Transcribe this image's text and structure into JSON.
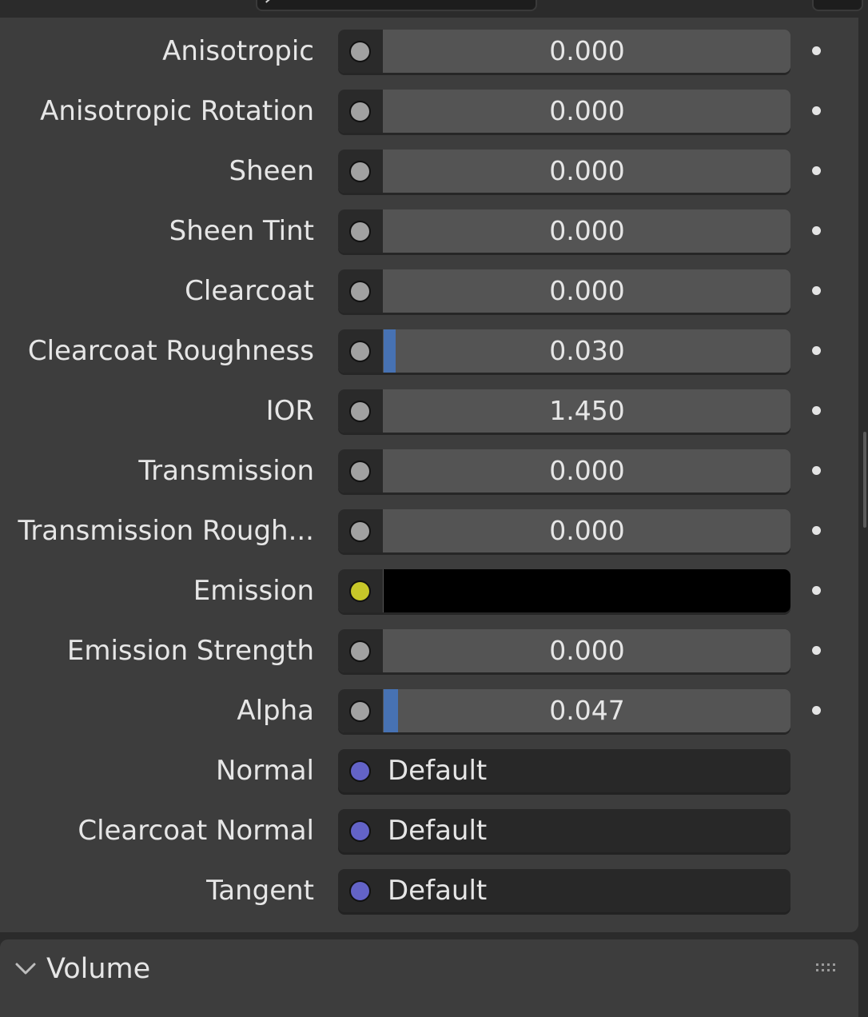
{
  "rows": [
    {
      "label": "Anisotropic",
      "kind": "value",
      "value": "0.000",
      "fill_fraction": 0.0,
      "socket_color": "#a1a1a1"
    },
    {
      "label": "Anisotropic Rotation",
      "kind": "value",
      "value": "0.000",
      "fill_fraction": 0.0,
      "socket_color": "#a1a1a1"
    },
    {
      "label": "Sheen",
      "kind": "value",
      "value": "0.000",
      "fill_fraction": 0.0,
      "socket_color": "#a1a1a1"
    },
    {
      "label": "Sheen Tint",
      "kind": "value",
      "value": "0.000",
      "fill_fraction": 0.0,
      "socket_color": "#a1a1a1"
    },
    {
      "label": "Clearcoat",
      "kind": "value",
      "value": "0.000",
      "fill_fraction": 0.0,
      "socket_color": "#a1a1a1"
    },
    {
      "label": "Clearcoat Roughness",
      "kind": "value",
      "value": "0.030",
      "fill_fraction": 0.03,
      "socket_color": "#a1a1a1"
    },
    {
      "label": "IOR",
      "kind": "value",
      "value": "1.450",
      "fill_fraction": 0.0,
      "socket_color": "#a1a1a1"
    },
    {
      "label": "Transmission",
      "kind": "value",
      "value": "0.000",
      "fill_fraction": 0.0,
      "socket_color": "#a1a1a1"
    },
    {
      "label": "Transmission Rough...",
      "kind": "value",
      "value": "0.000",
      "fill_fraction": 0.0,
      "socket_color": "#a1a1a1"
    },
    {
      "label": "Emission",
      "kind": "color",
      "swatch": "#000000",
      "socket_color": "#c7c729"
    },
    {
      "label": "Emission Strength",
      "kind": "value",
      "value": "0.000",
      "fill_fraction": 0.0,
      "socket_color": "#a1a1a1"
    },
    {
      "label": "Alpha",
      "kind": "value",
      "value": "0.047",
      "fill_fraction": 0.047,
      "socket_color": "#a1a1a1"
    },
    {
      "label": "Normal",
      "kind": "link",
      "value": "Default",
      "socket_color": "#6363c7"
    },
    {
      "label": "Clearcoat Normal",
      "kind": "link",
      "value": "Default",
      "socket_color": "#6363c7"
    },
    {
      "label": "Tangent",
      "kind": "link",
      "value": "Default",
      "socket_color": "#6363c7"
    }
  ],
  "section": {
    "title": "Volume",
    "icon": "chevron-down-icon",
    "handle_icon": "drag-handle-icon"
  },
  "colors": {
    "panel_bg": "#3d3d3d",
    "field_bg": "#545454",
    "slider_fill": "#4772b3",
    "text": "#e6e6e6"
  }
}
